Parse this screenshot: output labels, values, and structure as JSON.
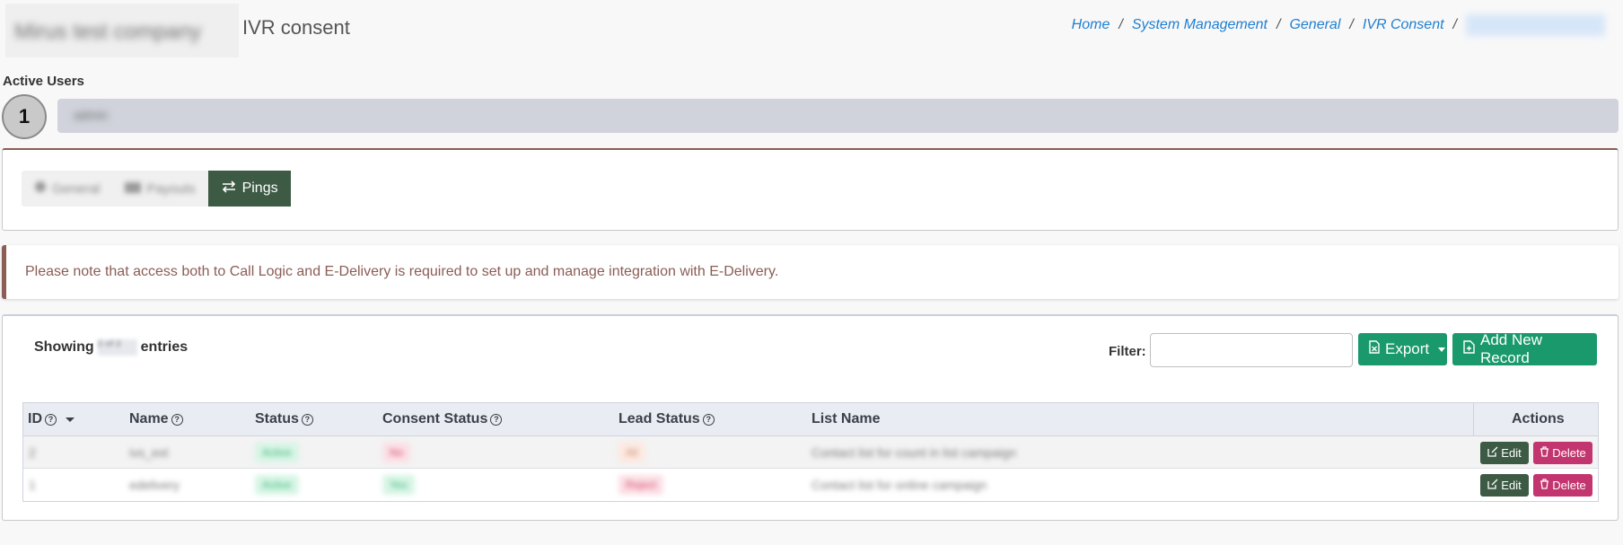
{
  "header": {
    "company_name": "Mirus test company",
    "page_title": "IVR consent",
    "breadcrumb": [
      "Home",
      "System Management",
      "General",
      "IVR Consent"
    ]
  },
  "active_users": {
    "label": "Active Users",
    "count": "1",
    "user_name": "admin"
  },
  "tabs": [
    {
      "label": "General",
      "icon": "gear-icon",
      "active": false
    },
    {
      "label": "Payouts",
      "icon": "money-icon",
      "active": false
    },
    {
      "label": "Pings",
      "icon": "exchange-arrows-icon",
      "active": true
    }
  ],
  "notice": {
    "text": "Please note that access both to Call Logic and E-Delivery is required to set up and manage integration with E-Delivery."
  },
  "toolbar": {
    "showing_prefix": "Showing",
    "showing_count": "2 of 2",
    "showing_suffix": "entries",
    "filter_label": "Filter:",
    "filter_value": "",
    "export_label": "Export",
    "add_label": "Add New Record"
  },
  "table": {
    "columns": [
      "ID",
      "Name",
      "Status",
      "Consent Status",
      "Lead Status",
      "List Name",
      "Actions"
    ],
    "rows": [
      {
        "id": "2",
        "name": "ivs_ext",
        "status": "Active",
        "consent_status": "No",
        "lead_status": "All",
        "list_name": "Contact list for count in list campaign"
      },
      {
        "id": "1",
        "name": "edelivery",
        "status": "Active",
        "consent_status": "Yes",
        "lead_status": "Reject",
        "list_name": "Contact list for online campaign"
      }
    ],
    "edit_label": "Edit",
    "delete_label": "Delete"
  },
  "colors": {
    "primary_green": "#1a9a6c",
    "dark_green": "#3d5a45",
    "delete_pink": "#c2356e",
    "link_blue": "#1e7fd0",
    "notice_brown": "#8b5d55"
  }
}
